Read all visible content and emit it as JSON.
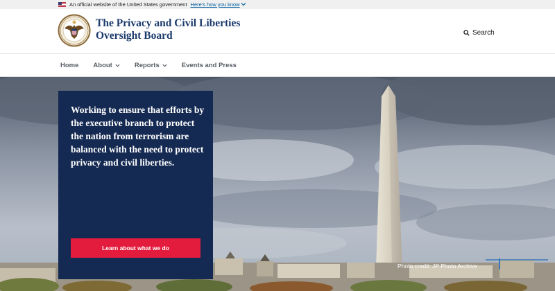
{
  "gov_banner": {
    "text": "An official website of the United States government",
    "link": "Here's how you know"
  },
  "header": {
    "title_line1": "The Privacy and Civil Liberties",
    "title_line2": "Oversight Board",
    "search_label": "Search"
  },
  "nav": {
    "items": [
      {
        "label": "Home"
      },
      {
        "label": "About"
      },
      {
        "label": "Reports"
      },
      {
        "label": "Events and Press"
      }
    ]
  },
  "hero": {
    "text": "Working to ensure that efforts by the executive branch to protect the nation from terrorism are balanced with the need to protect privacy and civil liberties.",
    "cta_label": "Learn about what we do",
    "credit": "Photo credit: JP Photo Archive"
  },
  "colors": {
    "navy": "#152a52",
    "red": "#e31c3d",
    "title_blue": "#1a3a6b",
    "link_blue": "#005ea2"
  }
}
